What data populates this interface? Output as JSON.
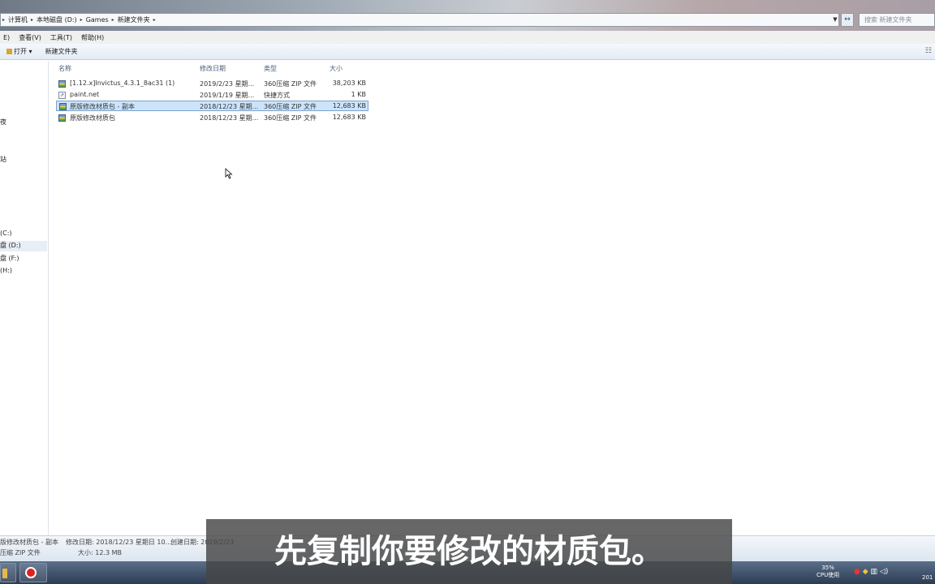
{
  "address_bar": {
    "segments": [
      "计算机",
      "本地磁盘 (D:)",
      "Games",
      "新建文件夹"
    ],
    "search_placeholder": "搜索 新建文件夹"
  },
  "menu": [
    "E)",
    "查看(V)",
    "工具(T)",
    "帮助(H)"
  ],
  "toolbar": {
    "open_label": "打开",
    "new_folder_label": "新建文件夹"
  },
  "nav_pane": {
    "items": [
      "夜",
      "站",
      "(C:)",
      "盘 (D:)",
      "盘 (F:)",
      "(H:)"
    ],
    "selected_index": 3
  },
  "columns": [
    "名称",
    "修改日期",
    "类型",
    "大小"
  ],
  "files": [
    {
      "name": "[1.12.x]Invictus_4.3.1_8ac31 (1)",
      "date": "2019/2/23 星期...",
      "type": "360压缩 ZIP 文件",
      "size": "38,203 KB",
      "icon": "zip-file-icon"
    },
    {
      "name": "paint.net",
      "date": "2019/1/19 星期...",
      "type": "快捷方式",
      "size": "1 KB",
      "icon": "shortcut-icon"
    },
    {
      "name": "原版修改材质包 - 副本",
      "date": "2018/12/23 星期...",
      "type": "360压缩 ZIP 文件",
      "size": "12,683 KB",
      "icon": "zip-file-icon"
    },
    {
      "name": "原版修改材质包",
      "date": "2018/12/23 星期...",
      "type": "360压缩 ZIP 文件",
      "size": "12,683 KB",
      "icon": "zip-file-icon"
    }
  ],
  "selected_file_index": 2,
  "details_pane": {
    "name": "版修改材质包 - 副本",
    "modified": "修改日期: 2018/12/23 星期日 10...",
    "created": "创建日期: 2019/2/23",
    "type": "压缩 ZIP 文件",
    "size": "大小: 12.3 MB"
  },
  "taskbar": {
    "cpu_percent": "35%",
    "cpu_label": "CPU使用",
    "clock": "201"
  },
  "subtitle": "先复制你要修改的材质包。",
  "colors": {
    "selection_bg": "#cce4fb",
    "selection_border": "#7da2ce",
    "header_text": "#4c607a"
  }
}
